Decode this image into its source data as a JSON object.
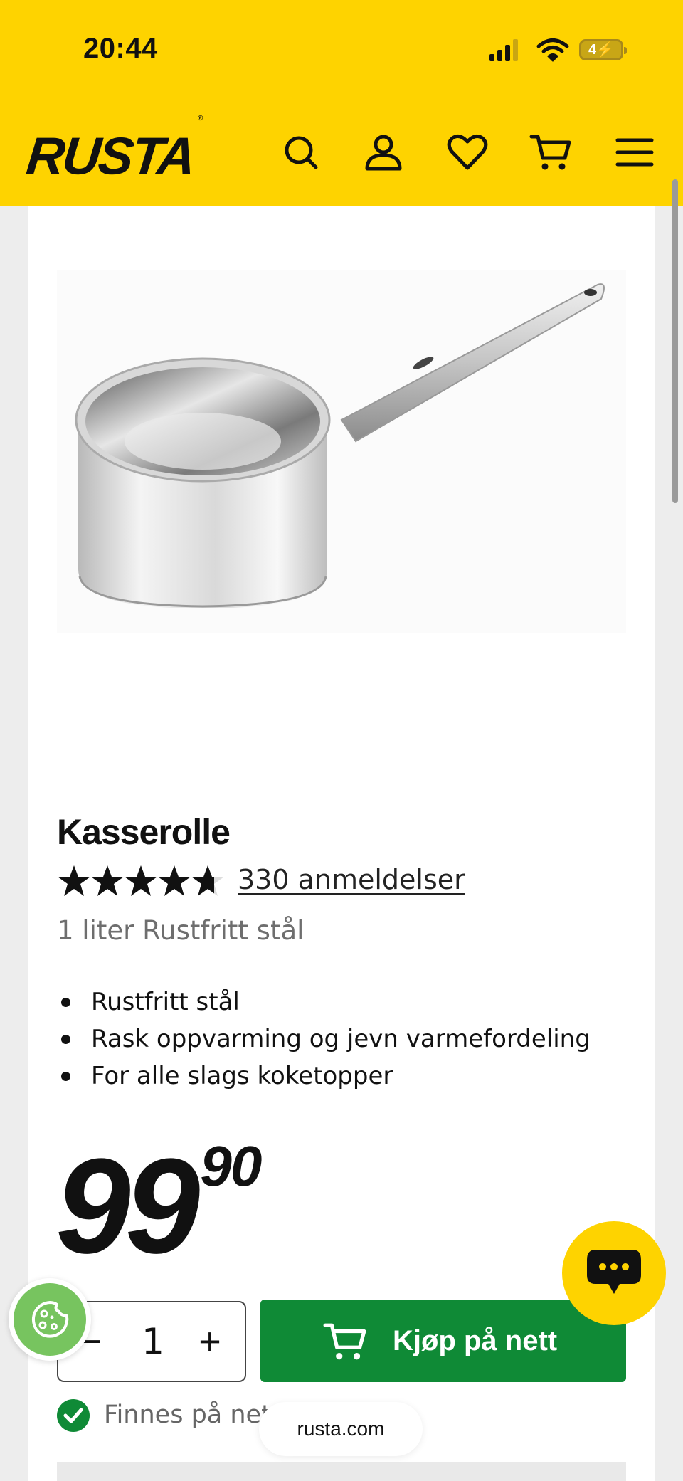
{
  "status_bar": {
    "time": "20:44",
    "battery": "4"
  },
  "header": {
    "logo": "RUSTA",
    "logo_mark": "®",
    "icons": [
      "search-icon",
      "account-icon",
      "heart-icon",
      "cart-icon",
      "menu-icon"
    ]
  },
  "product": {
    "title": "Kasserolle",
    "rating": 4.7,
    "rating_max": 5,
    "reviews_label": "330 anmeldelser",
    "subtitle": "1 liter Rustfritt stål",
    "features": [
      "Rustfritt stål",
      "Rask oppvarming og jevn varmefordeling",
      "For alle slags koketopper"
    ],
    "price_int": "99",
    "price_dec": "90",
    "quantity": "1",
    "qty_minus": "−",
    "qty_plus": "+",
    "buy_label": "Kjøp på nett",
    "availability": "Finnes på nett"
  },
  "browser": {
    "url": "rusta.com"
  },
  "colors": {
    "brand_yellow": "#fed300",
    "buy_green": "#0f8a36",
    "cookie_green": "#77c45f"
  }
}
